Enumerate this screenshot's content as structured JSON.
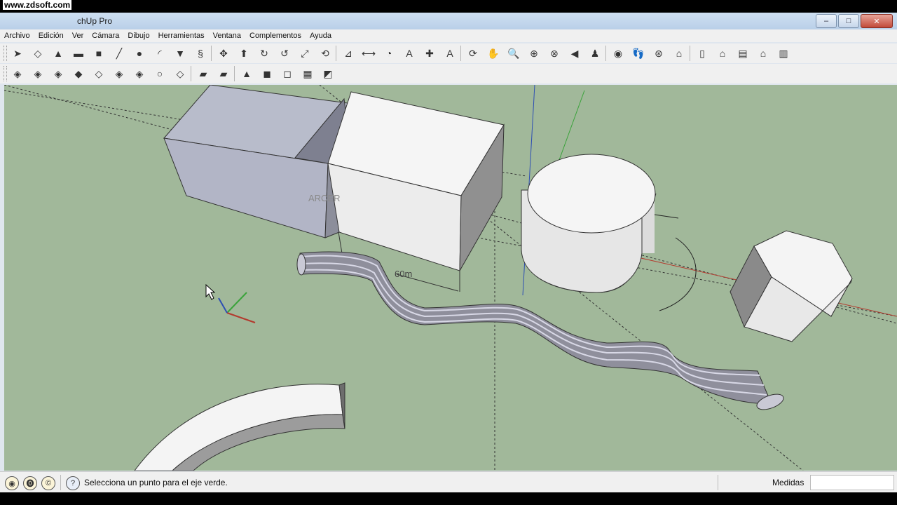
{
  "watermark": "www.zdsoft.com",
  "window": {
    "title": "chUp Pro"
  },
  "window_controls": {
    "minimize": "–",
    "maximize": "□",
    "close": "✕"
  },
  "menu": [
    "Archivo",
    "Edición",
    "Ver",
    "Cámara",
    "Dibujo",
    "Herramientas",
    "Ventana",
    "Complementos",
    "Ayuda"
  ],
  "toolbar1": [
    {
      "name": "select-tool-icon",
      "glyph": "➤"
    },
    {
      "name": "make-component-icon",
      "glyph": "◇"
    },
    {
      "name": "paint-bucket-icon",
      "glyph": "▲"
    },
    {
      "name": "eraser-icon",
      "glyph": "▬"
    },
    {
      "name": "rectangle-tool-icon",
      "glyph": "■"
    },
    {
      "name": "line-tool-icon",
      "glyph": "╱"
    },
    {
      "name": "circle-tool-icon",
      "glyph": "●"
    },
    {
      "name": "arc-tool-icon",
      "glyph": "◜"
    },
    {
      "name": "polygon-tool-icon",
      "glyph": "▼"
    },
    {
      "name": "freehand-tool-icon",
      "glyph": "§"
    },
    {
      "name": "move-tool-icon",
      "glyph": "✥"
    },
    {
      "name": "push-pull-icon",
      "glyph": "⬆"
    },
    {
      "name": "rotate-tool-icon",
      "glyph": "↻"
    },
    {
      "name": "follow-me-icon",
      "glyph": "↺"
    },
    {
      "name": "scale-tool-icon",
      "glyph": "⤢"
    },
    {
      "name": "offset-tool-icon",
      "glyph": "⟲"
    },
    {
      "name": "tape-measure-icon",
      "glyph": "⊿"
    },
    {
      "name": "dimension-tool-icon",
      "glyph": "⟷"
    },
    {
      "name": "protractor-icon",
      "glyph": "◔"
    },
    {
      "name": "text-tool-icon",
      "glyph": "A"
    },
    {
      "name": "axes-tool-icon",
      "glyph": "✚"
    },
    {
      "name": "3d-text-icon",
      "glyph": "A"
    },
    {
      "name": "orbit-tool-icon",
      "glyph": "⟳"
    },
    {
      "name": "pan-tool-icon",
      "glyph": "✋"
    },
    {
      "name": "zoom-tool-icon",
      "glyph": "🔍"
    },
    {
      "name": "zoom-window-icon",
      "glyph": "⊕"
    },
    {
      "name": "zoom-extents-icon",
      "glyph": "⊗"
    },
    {
      "name": "previous-view-icon",
      "glyph": "◀"
    },
    {
      "name": "position-camera-icon",
      "glyph": "♟"
    },
    {
      "name": "look-around-icon",
      "glyph": "◉"
    },
    {
      "name": "walk-tool-icon",
      "glyph": "👣"
    },
    {
      "name": "section-plane-icon",
      "glyph": "⊛"
    },
    {
      "name": "iso-view-icon",
      "glyph": "⌂"
    },
    {
      "name": "top-view-icon",
      "glyph": "▯"
    },
    {
      "name": "front-view-icon",
      "glyph": "⌂"
    },
    {
      "name": "right-view-icon",
      "glyph": "▤"
    },
    {
      "name": "back-view-icon",
      "glyph": "⌂"
    },
    {
      "name": "left-view-icon",
      "glyph": "▥"
    }
  ],
  "toolbar2": [
    {
      "name": "xray-style-icon",
      "glyph": "◈"
    },
    {
      "name": "wireframe-style-icon",
      "glyph": "◈"
    },
    {
      "name": "hidden-line-style-icon",
      "glyph": "◈"
    },
    {
      "name": "shaded-style-icon",
      "glyph": "◆"
    },
    {
      "name": "shaded-textures-icon",
      "glyph": "◇"
    },
    {
      "name": "monochrome-style-icon",
      "glyph": "◈"
    },
    {
      "name": "back-edges-icon",
      "glyph": "◈"
    },
    {
      "name": "sandbox-contours-icon",
      "glyph": "○"
    },
    {
      "name": "sandbox-scratch-icon",
      "glyph": "◇"
    },
    {
      "name": "smoove-icon",
      "glyph": "▰"
    },
    {
      "name": "stamp-icon",
      "glyph": "▰"
    },
    {
      "name": "drape-icon",
      "glyph": "▲"
    },
    {
      "name": "add-detail-icon",
      "glyph": "◼"
    },
    {
      "name": "flip-edge-icon",
      "glyph": "◻"
    },
    {
      "name": "terrain-icon",
      "glyph": "▦"
    },
    {
      "name": "sandbox-extra-icon",
      "glyph": "◩"
    }
  ],
  "scene": {
    "dimension_label": "60m",
    "ghost_text": "ARCER"
  },
  "status": {
    "hint_text": "Selecciona un punto para el eje verde.",
    "measures_label": "Medidas",
    "measures_value": ""
  },
  "colors": {
    "viewport_bg": "#a1b89a",
    "axis_red": "#b33a2e",
    "axis_green": "#3aa33a",
    "axis_blue": "#2e4fb3"
  }
}
